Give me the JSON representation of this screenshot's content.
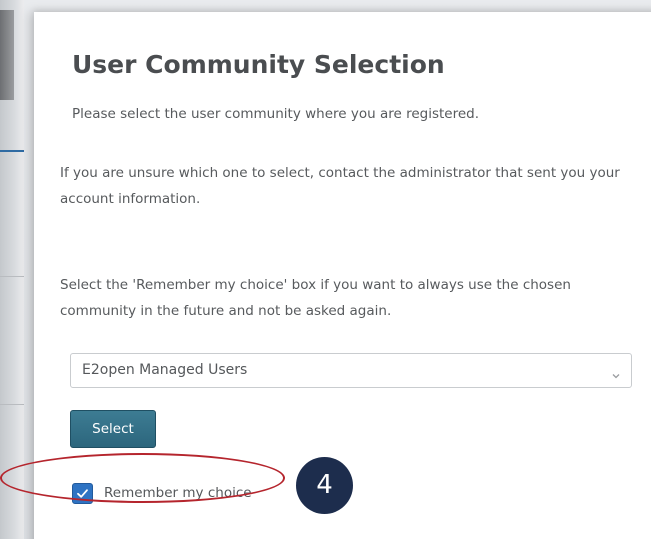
{
  "dialog": {
    "title": "User Community Selection",
    "intro": "Please select the user community where you are registered.",
    "unsure_text": "If you are unsure which one to select, contact the administrator that sent you your account information.",
    "remember_text": "Select the 'Remember my choice' box if you want to always use the chosen community in the future and not be asked again."
  },
  "community_select": {
    "selected_value": "E2open Managed Users",
    "icon": "chevron-down-icon"
  },
  "select_button": {
    "label": "Select"
  },
  "remember_checkbox": {
    "label": "Remember my choice",
    "checked": true,
    "icon": "checkmark-icon"
  },
  "annotation": {
    "step_number": "4",
    "highlight_color": "#b5252d",
    "badge_color": "#1d2d4d"
  },
  "colors": {
    "button_bg": "#2c667d",
    "checkbox_bg": "#2e73c3",
    "text": "#575a5d",
    "title": "#4a4d50"
  }
}
